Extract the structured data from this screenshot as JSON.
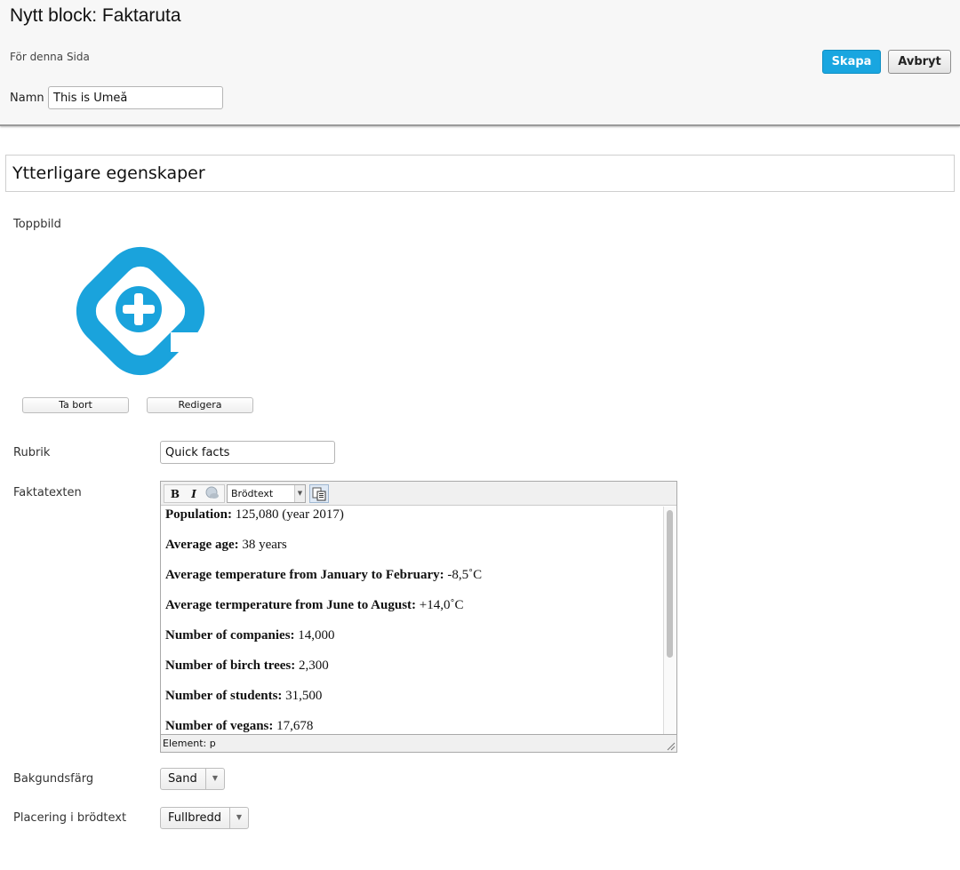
{
  "header": {
    "title": "Nytt block: Faktaruta",
    "context": "För denna Sida",
    "name_label": "Namn",
    "name_value": "This is Umeå",
    "create_label": "Skapa",
    "cancel_label": "Avbryt"
  },
  "section": {
    "title": "Ytterligare egenskaper"
  },
  "fields": {
    "top_image_label": "Toppbild",
    "remove_label": "Ta bort",
    "edit_label": "Redigera",
    "heading_label": "Rubrik",
    "heading_value": "Quick facts",
    "facts_label": "Faktatexten",
    "background_label": "Bakgundsfärg",
    "background_value": "Sand",
    "placement_label": "Placering i brödtext",
    "placement_value": "Fullbredd"
  },
  "editor": {
    "bold_label": "B",
    "italic_label": "I",
    "format_value": "Brödtext",
    "status": "Element: p",
    "rows": [
      {
        "label": "Population:",
        "value": " 125,080 (year 2017)"
      },
      {
        "label": "Average age:",
        "value": " 38 years"
      },
      {
        "label": "Average temperature from January to February:",
        "value": " -8,5˚C"
      },
      {
        "label": "Average termperature from June to August:",
        "value": " +14,0˚C"
      },
      {
        "label": "Number of companies:",
        "value": " 14,000"
      },
      {
        "label": "Number of birch trees:",
        "value": " 2,300"
      },
      {
        "label": "Number of students:",
        "value": " 31,500"
      },
      {
        "label": "Number of vegans:",
        "value": " 17,678"
      }
    ]
  },
  "colors": {
    "accent": "#19a6e0",
    "logo": "#1aa3dc"
  },
  "icons": {
    "logo": "medical-plus-logo",
    "link": "link-icon",
    "paste": "paste-word-icon"
  }
}
